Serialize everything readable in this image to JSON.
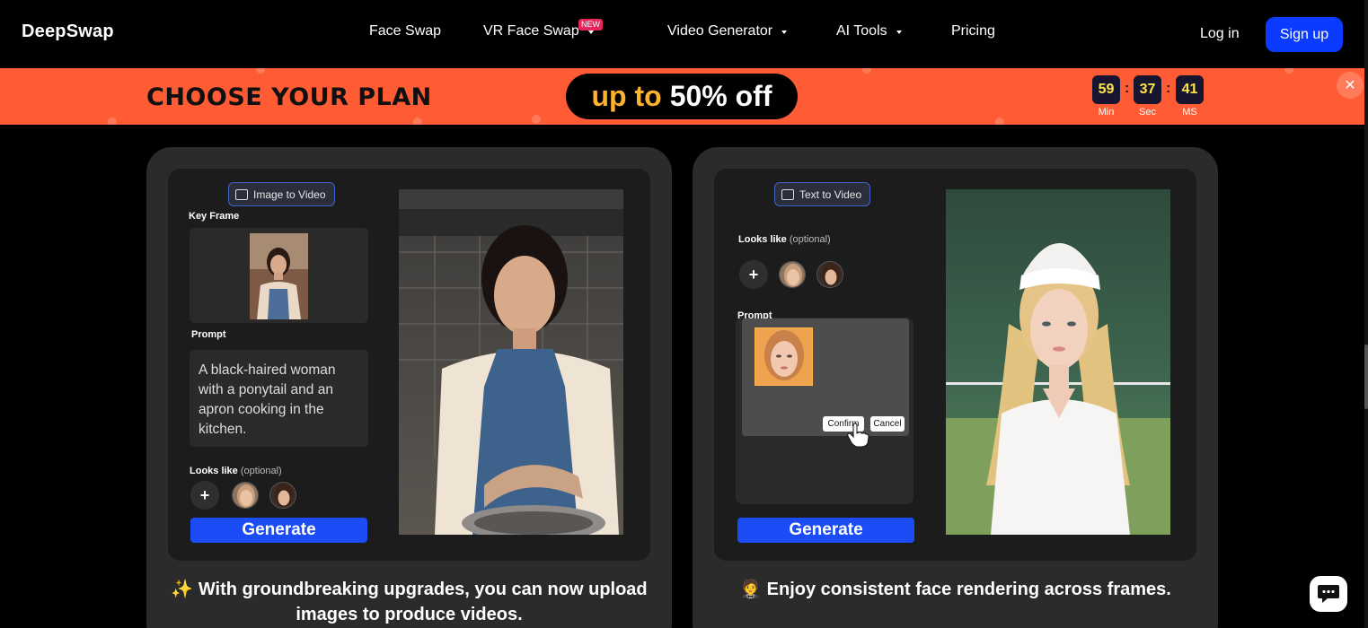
{
  "nav": {
    "logo": "DeepSwap",
    "items": [
      {
        "label": "Face Swap"
      },
      {
        "label": "VR Face Swap",
        "badge": "NEW"
      },
      {
        "label": "Video Generator"
      },
      {
        "label": "AI Tools"
      },
      {
        "label": "Pricing"
      }
    ],
    "login": "Log in",
    "signup": "Sign up"
  },
  "promo": {
    "headline": "CHOOSE YOUR PLAN",
    "deal_prefix": "up to",
    "deal_value": "50% off",
    "timer": [
      {
        "value": "59",
        "unit": "Min"
      },
      {
        "value": "37",
        "unit": "Sec"
      },
      {
        "value": "41",
        "unit": "MS"
      }
    ],
    "separator": ":",
    "close": "✕"
  },
  "cards": [
    {
      "mode_chip": "Image to Video",
      "key_frame_label": "Key Frame",
      "prompt_label": "Prompt",
      "prompt_text": "A black-haired woman with a ponytail and an apron cooking in the kitchen.",
      "looks_like_label": "Looks like",
      "looks_like_optional": "(optional)",
      "add": "+",
      "generate": "Generate",
      "caption_icon": "✨",
      "caption": "With groundbreaking upgrades, you can now upload images to produce videos."
    },
    {
      "mode_chip": "Text to Video",
      "looks_like_label": "Looks like",
      "looks_like_optional": "(optional)",
      "add": "+",
      "prompt_label": "Prompt",
      "confirm": "Confirm",
      "cancel": "Cancel",
      "generate": "Generate",
      "caption_icon": "🤵",
      "caption": "Enjoy consistent face rendering across frames."
    }
  ],
  "colors": {
    "accent_blue": "#1c4cf5",
    "promo_orange": "#ff5b34",
    "timer_yellow": "#ffe44a",
    "deal_orange": "#ffb22d"
  },
  "icons": {
    "chat": "chat-bubble-icon",
    "close": "close-icon",
    "caret": "chevron-down-icon"
  }
}
